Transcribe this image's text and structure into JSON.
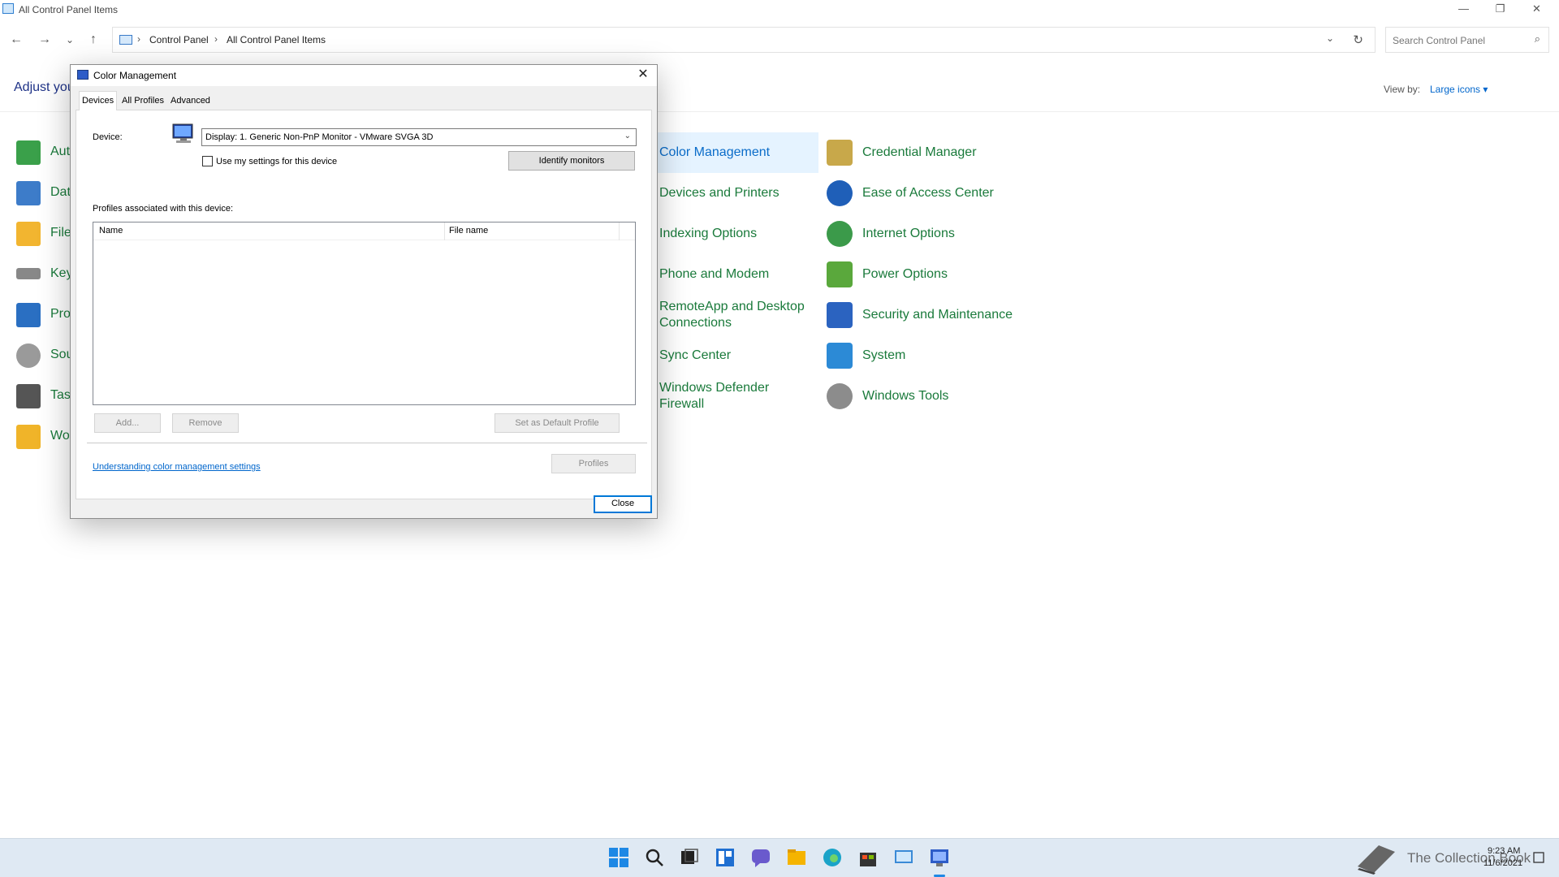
{
  "window": {
    "title": "All Control Panel Items",
    "minimize": "—",
    "restore": "❐",
    "close": "✕"
  },
  "address": {
    "back": "←",
    "forward": "→",
    "recent": "⌄",
    "up": "↑",
    "crumbs": [
      "Control Panel",
      "All Control Panel Items"
    ],
    "separator": "›",
    "dropdown": "⌄",
    "refresh": "↻"
  },
  "search": {
    "placeholder": "Search Control Panel",
    "icon": "⌕"
  },
  "header": {
    "adjust": "Adjust you",
    "view_by_label": "View by:",
    "view_by_value": "Large icons ▾"
  },
  "left_items": [
    {
      "label": "Aut",
      "icon": "autoplay-icon",
      "color": "#3aa04a"
    },
    {
      "label": "Dat",
      "icon": "date-time-icon",
      "color": "#3d7cc9"
    },
    {
      "label": "File",
      "icon": "file-explorer-options-icon",
      "color": "#f2b530"
    },
    {
      "label": "Key",
      "icon": "keyboard-icon",
      "color": "#888888"
    },
    {
      "label": "Pro",
      "icon": "programs-icon",
      "color": "#2a6fc2"
    },
    {
      "label": "Sou",
      "icon": "sound-icon",
      "color": "#9a9a9a"
    },
    {
      "label": "Tasl",
      "icon": "taskbar-icon",
      "color": "#555555"
    },
    {
      "label": "Wo",
      "icon": "work-folders-icon",
      "color": "#f0b429"
    }
  ],
  "middle_items": [
    {
      "label": "Color Management",
      "selected": true
    },
    {
      "label": "Devices and Printers"
    },
    {
      "label": "Indexing Options"
    },
    {
      "label": "Phone and Modem"
    },
    {
      "label": "RemoteApp and Desktop Connections"
    },
    {
      "label": "Sync Center"
    },
    {
      "label": "Windows Defender Firewall"
    }
  ],
  "right_items": [
    {
      "label": "Credential Manager",
      "icon": "credential-manager-icon",
      "color": "#c8a84a"
    },
    {
      "label": "Ease of Access Center",
      "icon": "ease-of-access-icon",
      "color": "#1f5fb8"
    },
    {
      "label": "Internet Options",
      "icon": "internet-options-icon",
      "color": "#3b9a4a"
    },
    {
      "label": "Power Options",
      "icon": "power-options-icon",
      "color": "#5aa83c"
    },
    {
      "label": "Security and Maintenance",
      "icon": "security-flag-icon",
      "color": "#2b63c0"
    },
    {
      "label": "System",
      "icon": "system-icon",
      "color": "#2c8ad6"
    },
    {
      "label": "Windows Tools",
      "icon": "windows-tools-icon",
      "color": "#8c8c8c"
    }
  ],
  "dialog": {
    "title": "Color Management",
    "close_glyph": "✕",
    "tabs": [
      "Devices",
      "All Profiles",
      "Advanced"
    ],
    "device_label": "Device:",
    "device_value": "Display: 1. Generic Non-PnP Monitor - VMware SVGA 3D",
    "select_arrow": "⌄",
    "use_settings": "Use my settings for this device",
    "identify": "Identify monitors",
    "profiles_label": "Profiles associated with this device:",
    "columns": [
      "Name",
      "File name"
    ],
    "add": "Add...",
    "remove": "Remove",
    "set_default": "Set as Default Profile",
    "profiles": "Profiles",
    "link": "Understanding color management settings",
    "close": "Close"
  },
  "taskbar": {
    "icons": [
      {
        "name": "start-icon",
        "color": "#1e88e5"
      },
      {
        "name": "search-icon",
        "color": "#222222"
      },
      {
        "name": "task-view-icon",
        "color": "#222222"
      },
      {
        "name": "widgets-icon",
        "color": "#1f6fd1"
      },
      {
        "name": "chat-icon",
        "color": "#6a5acd"
      },
      {
        "name": "file-explorer-icon",
        "color": "#f5b400"
      },
      {
        "name": "edge-icon",
        "color": "#1aa3c8"
      },
      {
        "name": "store-icon",
        "color": "#333333"
      },
      {
        "name": "control-panel-icon",
        "color": "#3a8ad6"
      },
      {
        "name": "color-management-icon",
        "color": "#2d5cc8"
      }
    ],
    "time": "9:23 AM",
    "date": "11/6/2021",
    "watermark": "The Collection Book"
  }
}
